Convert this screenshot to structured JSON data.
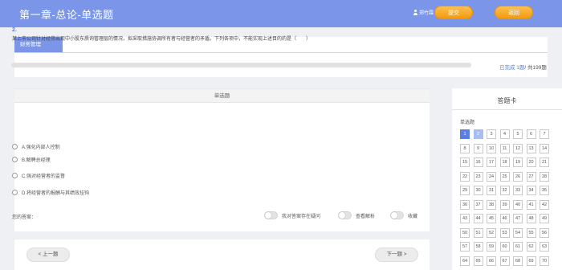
{
  "header": {
    "title": "第一章-总论-单选题",
    "user_name": "郑竹霖",
    "submit_label": "提交",
    "back_label": "返回"
  },
  "subject": {
    "tab_label": "财务管理",
    "progress_done_text": "已完成 1题",
    "progress_total_text": "/ 共199题",
    "progress_fraction": 0.005
  },
  "question": {
    "header": "单选题",
    "number": "2.",
    "text": "某上市公司针对经常出现中小股东质询管理层的情况，拟采取措施协调所有者与经营者的矛盾。下列各项中，不能实现上述目的的是（　　）",
    "options": [
      "A.强化内部人控制",
      "B.解聘总经理",
      "C.强对经营者的监督",
      "D.将经营者的报酬与其绩效挂钩"
    ],
    "answer_label": "您的答案：",
    "toggle_doubt": "我对答案存在疑问",
    "toggle_analysis": "查看解析",
    "toggle_favorite": "收藏"
  },
  "nav": {
    "prev_label": "< 上一题",
    "next_label": "下一题 >"
  },
  "answer_card": {
    "title": "答题卡",
    "section": "单选题",
    "current": 1,
    "answered": [
      2
    ],
    "numbers": [
      "1",
      "2",
      "3",
      "4",
      "5",
      "6",
      "7",
      "8",
      "9",
      "10",
      "11",
      "12",
      "13",
      "14",
      "15",
      "16",
      "17",
      "18",
      "19",
      "20",
      "21",
      "22",
      "23",
      "24",
      "25",
      "26",
      "27",
      "28",
      "29",
      "30",
      "31",
      "32",
      "33",
      "34",
      "35",
      "36",
      "37",
      "38",
      "39",
      "40",
      "41",
      "42",
      "43",
      "44",
      "45",
      "46",
      "47",
      "48",
      "49",
      "50",
      "51",
      "52",
      "53",
      "54",
      "55",
      "56",
      "57",
      "58",
      "59",
      "60",
      "61",
      "62",
      "63",
      "64",
      "65",
      "66",
      "67",
      "68",
      "69",
      "70",
      "71",
      "72",
      "73",
      "74",
      "75",
      "76",
      "77"
    ]
  },
  "colors": {
    "header_bg": "#7b96e9",
    "accent": "#5b7fe0",
    "button_orange": "#f5a623"
  }
}
